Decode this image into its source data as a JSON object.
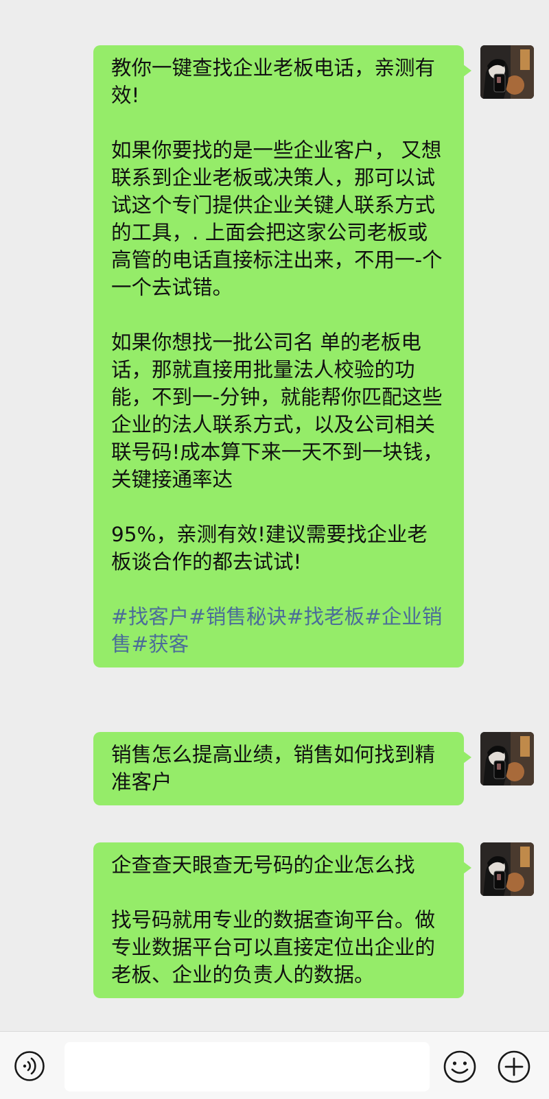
{
  "messages": [
    {
      "paragraphs": [
        "教你一键查找企业老板电话，亲测有效!",
        "如果你要找的是一些企业客户， 又想联系到企业老板或决策人，那可以试试这个专门提供企业关键人联系方式的工具，. 上面会把这家公司老板或高管的电话直接标注出来，不用一-个一个去试错。",
        "如果你想找一批公司名 单的老板电话，那就直接用批量法人校验的功能，不到一-分钟，就能帮你匹配这些企业的法人联系方式，以及公司相关联号码!成本算下来一天不到一块钱，关键接通率达",
        "95%，亲测有效!建议需要找企业老板谈合作的都去试试!"
      ],
      "tags": "#找客户#销售秘诀#找老板#企业销售#获客"
    },
    {
      "paragraphs": [
        "销售怎么提高业绩，销售如何找到精准客户"
      ]
    },
    {
      "paragraphs": [
        "企查查天眼查无号码的企业怎么找",
        "找号码就用专业的数据查询平台。做专业数据平台可以直接定位出企业的老板、企业的负责人的数据。"
      ]
    }
  ],
  "input_bar": {
    "voice_icon": "voice-icon",
    "input_value": "",
    "emoji_icon": "emoji-icon",
    "plus_icon": "plus-icon"
  },
  "colors": {
    "background": "#ededed",
    "bubble": "#95ec69",
    "tag_text": "#4b6d98",
    "input_bar": "#f7f7f7"
  }
}
